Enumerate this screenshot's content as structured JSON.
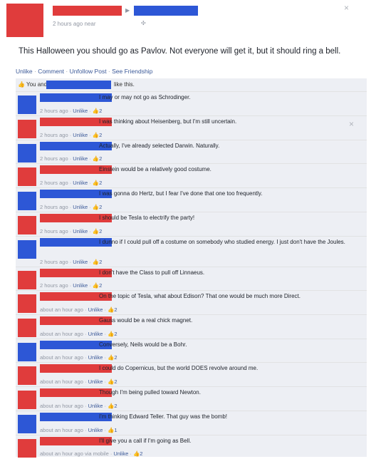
{
  "post": {
    "timestamp": "2 hours ago near",
    "body": "This Halloween you should go as Pavlov. Not everyone will get it, but it should ring a bell.",
    "close_label": "×",
    "actions": [
      "Unlike",
      "Comment",
      "Unfollow Post",
      "See Friendship"
    ],
    "likes_prefix": "You and",
    "likes_suffix": "like this.",
    "comment_close": "×"
  },
  "comments": [
    {
      "text": "I may or may not go as Schrodinger.",
      "time": "2 hours ago",
      "like": "Unlike",
      "count": "2"
    },
    {
      "text": "I was thinking about Heisenberg, but I'm still uncertain.",
      "time": "2 hours ago",
      "like": "Unlike",
      "count": "2"
    },
    {
      "text": "Actually, I've already selected Darwin. Naturally.",
      "time": "2 hours ago",
      "like": "Unlike",
      "count": "2"
    },
    {
      "text": "Einstein would be a relatively good costume.",
      "time": "2 hours ago",
      "like": "Unlike",
      "count": "2"
    },
    {
      "text": "I was gonna do Hertz, but I fear I've done that one too frequently.",
      "time": "2 hours ago",
      "like": "Unlike",
      "count": "2"
    },
    {
      "text": "I should be Tesla to electrify the party!",
      "time": "2 hours ago",
      "like": "Unlike",
      "count": "2"
    },
    {
      "text": "I dunno if I could pull off a costume on somebody who studied energy. I just don't have the Joules.",
      "time": "2 hours ago",
      "like": "Unlike",
      "count": "2"
    },
    {
      "text": "I don't have the Class to pull off Linnaeus.",
      "time": "2 hours ago",
      "like": "Unlike",
      "count": "2"
    },
    {
      "text": "On the topic of Tesla, what about Edison? That one would be much more Direct.",
      "time": "about an hour ago",
      "like": "Unlike",
      "count": "2"
    },
    {
      "text": "Gauss would be a real chick magnet.",
      "time": "about an hour ago",
      "like": "Unlike",
      "count": "2"
    },
    {
      "text": "Conversely, Neils would be a Bohr.",
      "time": "about an hour ago",
      "like": "Unlike",
      "count": "2"
    },
    {
      "text": "I could do Copernicus, but the world DOES revolve around me.",
      "time": "about an hour ago",
      "like": "Unlike",
      "count": "2"
    },
    {
      "text": "Though I'm being pulled toward Newton.",
      "time": "about an hour ago",
      "like": "Unlike",
      "count": "2"
    },
    {
      "text": "I'm thinking Edward Teller. That guy was the bomb!",
      "time": "about an hour ago",
      "like": "Unlike",
      "count": "1"
    },
    {
      "text": "I'll give you a call if I'm going as Bell.",
      "time": "about an hour ago via mobile",
      "like": "Unlike",
      "count": "2"
    }
  ],
  "colors": {
    "red": "#e03c3c",
    "blue": "#2d57d6",
    "link": "#3b5998",
    "feed_bg": "#edeff4"
  }
}
